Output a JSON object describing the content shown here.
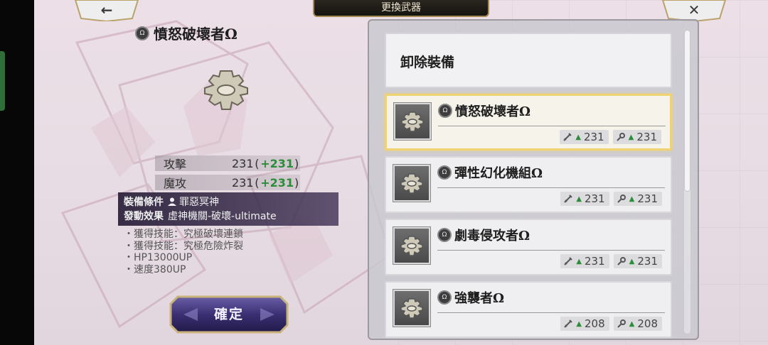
{
  "header": {
    "title": "更換武器",
    "back_glyph": "←",
    "close_glyph": "✕"
  },
  "detail": {
    "name": "憤怒破壞者Ω",
    "stats": [
      {
        "label": "攻擊",
        "value": "231",
        "open": "(",
        "bonus": "+231",
        "close": ")"
      },
      {
        "label": "魔攻",
        "value": "231",
        "open": "(",
        "bonus": "+231",
        "close": ")"
      }
    ],
    "condition_label": "裝備條件",
    "condition_value": "罪惡冥神",
    "effect_label": "發動效果",
    "effect_value": "虛神機關-破壞-ultimate",
    "skills": [
      "・獲得技能：究極破壞連鎖",
      "・獲得技能：究極危險炸裂",
      "・HP13000UP",
      "・速度380UP"
    ],
    "confirm_label": "確定"
  },
  "list": {
    "unequip_label": "卸除裝備",
    "items": [
      {
        "name": "憤怒破壞者Ω",
        "atk": "231",
        "mag": "231",
        "selected": true
      },
      {
        "name": "彈性幻化機組Ω",
        "atk": "231",
        "mag": "231",
        "selected": false
      },
      {
        "name": "劇毒侵攻者Ω",
        "atk": "231",
        "mag": "231",
        "selected": false
      },
      {
        "name": "強襲者Ω",
        "atk": "208",
        "mag": "208",
        "selected": false
      }
    ]
  },
  "colors": {
    "bonus_green": "#2b8c3a",
    "selected_border": "#f0d270",
    "panel_purple": "#2c2238"
  },
  "icons": {
    "weapon": "gear-icon",
    "rarity": "omega-badge-icon",
    "attack": "sword-icon",
    "magic": "wand-icon",
    "user": "person-icon"
  }
}
